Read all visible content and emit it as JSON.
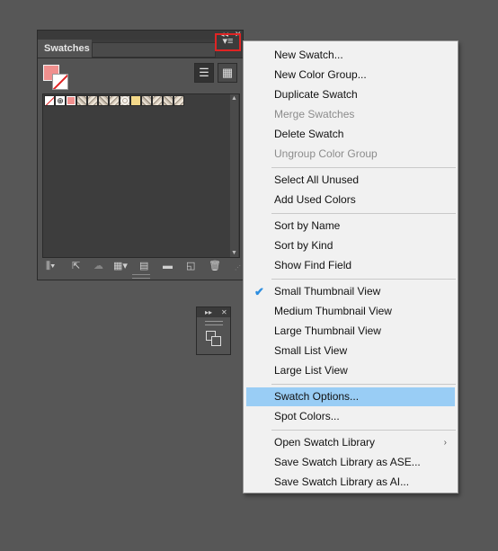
{
  "panel": {
    "title": "Swatches",
    "collapse_glyph": "◂◂",
    "close_glyph": "✕",
    "menu_glyph": "▾≡",
    "list_view_glyph": "☰",
    "grid_view_glyph": "▦",
    "registration_glyph": "⊕",
    "scroll_up_glyph": "▲",
    "scroll_down_glyph": "▼",
    "grip_glyph": "⋰",
    "bottom_icons": [
      {
        "name": "swatch-libraries-menu-icon",
        "glyph": "⫼▾"
      },
      {
        "name": "place-swatches-icon",
        "glyph": "⇱"
      },
      {
        "name": "cloud-library-icon",
        "glyph": "☁"
      },
      {
        "name": "show-swatch-kinds-icon",
        "glyph": "▦▾"
      },
      {
        "name": "swatch-options-icon",
        "glyph": "▤"
      },
      {
        "name": "new-color-group-icon",
        "glyph": "▬"
      },
      {
        "name": "new-swatch-icon",
        "glyph": "◱"
      },
      {
        "name": "delete-swatch-icon",
        "glyph": "🗑"
      }
    ]
  },
  "mini_panel": {
    "expand_glyph": "▸▸",
    "close_glyph": "✕"
  },
  "menu": {
    "items": [
      {
        "label": "New Swatch...",
        "disabled": false
      },
      {
        "label": "New Color Group...",
        "disabled": false
      },
      {
        "label": "Duplicate Swatch",
        "disabled": false
      },
      {
        "label": "Merge Swatches",
        "disabled": true
      },
      {
        "label": "Delete Swatch",
        "disabled": false
      },
      {
        "label": "Ungroup Color Group",
        "disabled": true
      },
      {
        "label": "Select All Unused",
        "disabled": false
      },
      {
        "label": "Add Used Colors",
        "disabled": false
      },
      {
        "label": "Sort by Name",
        "disabled": false
      },
      {
        "label": "Sort by Kind",
        "disabled": false
      },
      {
        "label": "Show Find Field",
        "disabled": false
      },
      {
        "label": "Small Thumbnail View",
        "disabled": false,
        "checked": true
      },
      {
        "label": "Medium Thumbnail View",
        "disabled": false
      },
      {
        "label": "Large Thumbnail View",
        "disabled": false
      },
      {
        "label": "Small List View",
        "disabled": false
      },
      {
        "label": "Large List View",
        "disabled": false
      },
      {
        "label": "Swatch Options...",
        "disabled": false,
        "highlighted": true
      },
      {
        "label": "Spot Colors...",
        "disabled": false
      },
      {
        "label": "Open Swatch Library",
        "disabled": false,
        "submenu": true
      },
      {
        "label": "Save Swatch Library as ASE...",
        "disabled": false
      },
      {
        "label": "Save Swatch Library as AI...",
        "disabled": false
      }
    ],
    "check_glyph": "✔",
    "submenu_glyph": "›"
  },
  "colors": {
    "fill": "#f0908e",
    "highlight": "#99cdf5",
    "accent_red": "#e02424"
  }
}
